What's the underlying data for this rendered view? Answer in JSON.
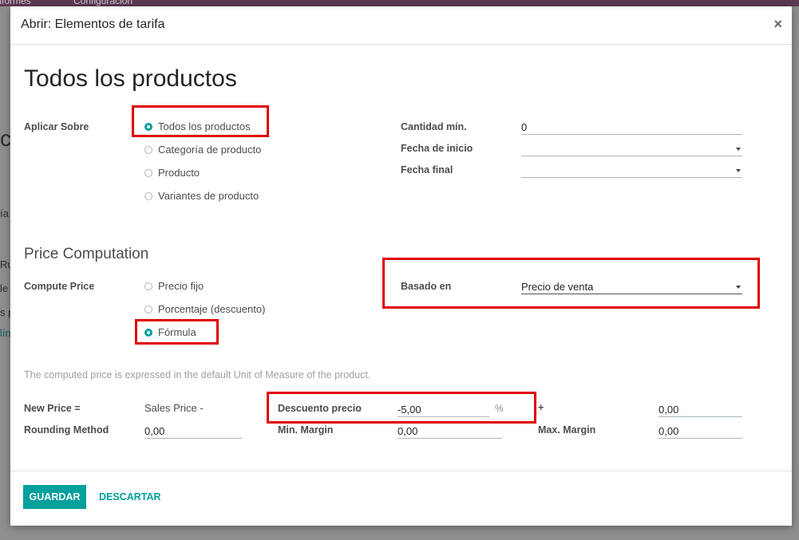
{
  "background": {
    "menu_informes": "Informes",
    "menu_configuracion": "Configuración",
    "fragments": [
      "ca",
      "ía",
      "Rul",
      "le",
      "s p",
      "líne"
    ]
  },
  "dialog": {
    "title": "Abrir: Elementos de tarifa",
    "close_symbol": "×",
    "record_name": "Todos los productos"
  },
  "apply": {
    "label": "Aplicar Sobre",
    "options": [
      "Todos los productos",
      "Categoría de producto",
      "Producto",
      "Variantes de producto"
    ],
    "selected": "Todos los productos"
  },
  "conditions": {
    "min_qty_label": "Cantidad mín.",
    "min_qty_value": "0",
    "start_date_label": "Fecha de inicio",
    "start_date_value": "",
    "end_date_label": "Fecha final",
    "end_date_value": ""
  },
  "price_computation": {
    "section_title": "Price Computation",
    "compute_label": "Compute Price",
    "options": [
      "Precio fijo",
      "Porcentaje (descuento)",
      "Fórmula"
    ],
    "selected": "Fórmula",
    "based_on_label": "Basado en",
    "based_on_value": "Precio de venta",
    "help_text": "The computed price is expressed in the default Unit of Measure of the product."
  },
  "formula": {
    "new_price_label": "New Price =",
    "sales_price_text": "Sales Price -",
    "discount_label": "Descuento precio",
    "discount_value": "-5,00",
    "percent_symbol": "%",
    "plus_symbol": "+",
    "surcharge_value": "0,00",
    "rounding_label": "Rounding Method",
    "rounding_value": "0,00",
    "min_margin_label": "Min. Margin",
    "min_margin_value": "0,00",
    "max_margin_label": "Max. Margin",
    "max_margin_value": "0,00"
  },
  "footer": {
    "save_label": "GUARDAR",
    "discard_label": "DESCARTAR"
  },
  "colors": {
    "primary": "#00a09d",
    "highlight": "#e00000",
    "topbar": "#5b3b53"
  }
}
